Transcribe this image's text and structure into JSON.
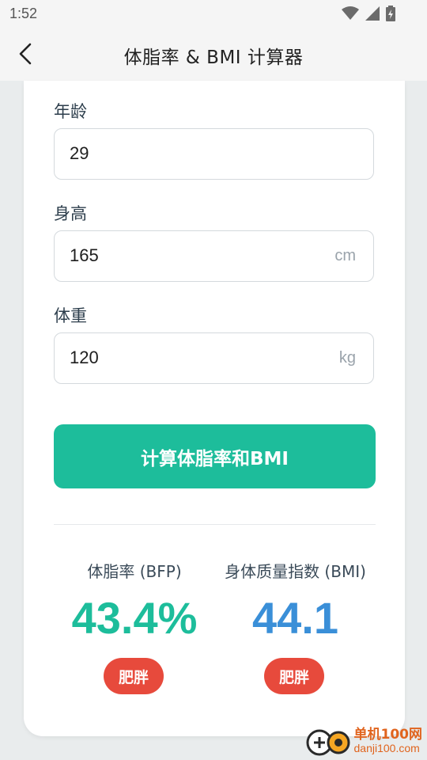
{
  "status_bar": {
    "time": "1:52",
    "icons": [
      "wifi-icon",
      "signal-icon",
      "battery-icon"
    ]
  },
  "header": {
    "back_icon": "chevron-left-icon",
    "title": "体脂率 & BMI 计算器"
  },
  "form": {
    "age": {
      "label": "年龄",
      "value": "29",
      "unit": ""
    },
    "height": {
      "label": "身高",
      "value": "165",
      "unit": "cm"
    },
    "weight": {
      "label": "体重",
      "value": "120",
      "unit": "kg"
    },
    "submit_label": "计算体脂率和BMI"
  },
  "results": {
    "bfp": {
      "label": "体脂率 (BFP)",
      "value": "43.4%",
      "badge": "肥胖",
      "color": "#1dbd9b"
    },
    "bmi": {
      "label": "身体质量指数 (BMI)",
      "value": "44.1",
      "badge": "肥胖",
      "color": "#3a8fd8"
    }
  },
  "colors": {
    "accent": "#1dbd9b",
    "bmi_blue": "#3a8fd8",
    "badge_red": "#e74a3c"
  },
  "watermark": {
    "cn": "单机100网",
    "en": "danji100.com"
  }
}
